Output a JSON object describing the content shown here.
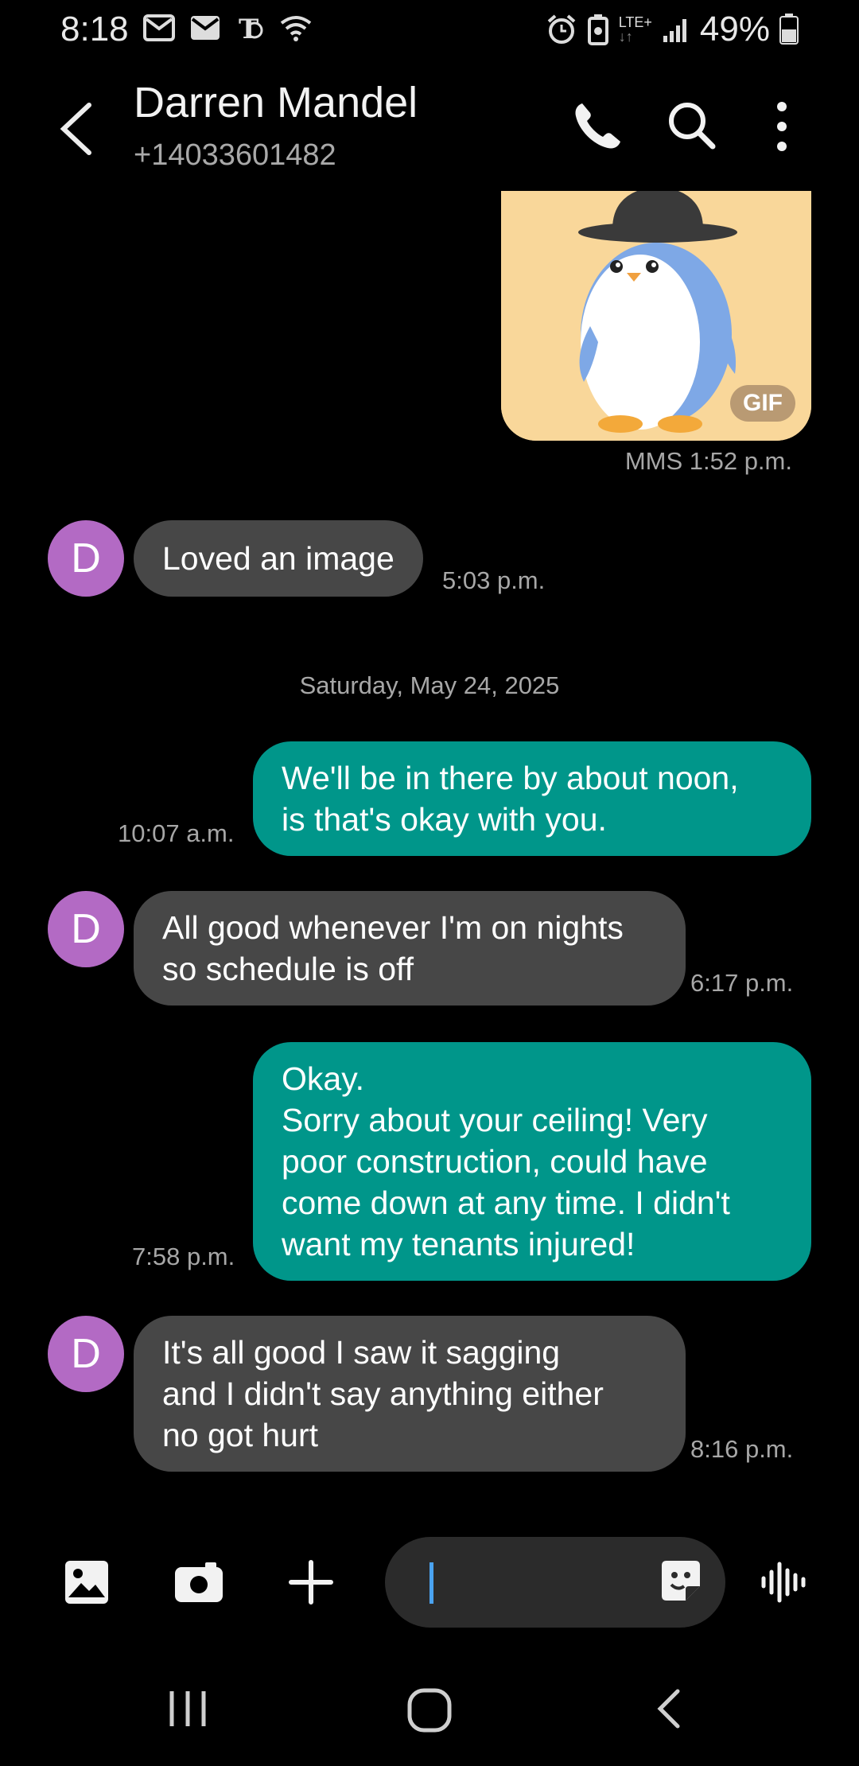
{
  "status_bar": {
    "time": "8:18",
    "network": "LTE+",
    "battery": "49%",
    "icons": [
      "mail-icon",
      "mail-icon",
      "news-icon",
      "wifi-icon",
      "alarm-icon",
      "battery-saver-icon",
      "signal-icon",
      "battery-icon"
    ]
  },
  "header": {
    "contact_name": "Darren Mandel",
    "contact_number": "+14033601482",
    "icons": [
      "back-icon",
      "phone-icon",
      "search-icon",
      "more-icon"
    ]
  },
  "messages": [
    {
      "type": "gif",
      "direction": "outgoing",
      "badge": "GIF",
      "meta": "MMS 1:52 p.m."
    },
    {
      "direction": "incoming",
      "avatar": "D",
      "text": "Loved an image",
      "time": "5:03 p.m."
    },
    {
      "type": "date",
      "text": "Saturday, May 24, 2025"
    },
    {
      "direction": "outgoing",
      "text": "We'll be in there by about noon,\nis that's okay with you.",
      "time": "10:07 a.m."
    },
    {
      "direction": "incoming",
      "avatar": "D",
      "text": "All good whenever I'm on nights\nso schedule is off",
      "time": "6:17 p.m."
    },
    {
      "direction": "outgoing",
      "text": "Okay.\nSorry about your ceiling! Very\npoor construction, could have\ncome down at any time. I didn't\nwant my tenants injured!",
      "time": "7:58 p.m."
    },
    {
      "direction": "incoming",
      "avatar": "D",
      "text": "It's all good I saw it sagging\nand I didn't say anything either\nno got hurt",
      "time": "8:16 p.m."
    }
  ],
  "composer": {
    "icons": [
      "gallery-icon",
      "camera-icon",
      "add-icon",
      "sticker-icon",
      "voice-icon"
    ],
    "input_value": ""
  },
  "colors": {
    "outgoing_bubble": "#00968a",
    "incoming_bubble": "#474747",
    "avatar": "#b36ac4",
    "background": "#000000"
  },
  "navbar": {
    "icons": [
      "recents-icon",
      "home-icon",
      "back-nav-icon"
    ]
  }
}
